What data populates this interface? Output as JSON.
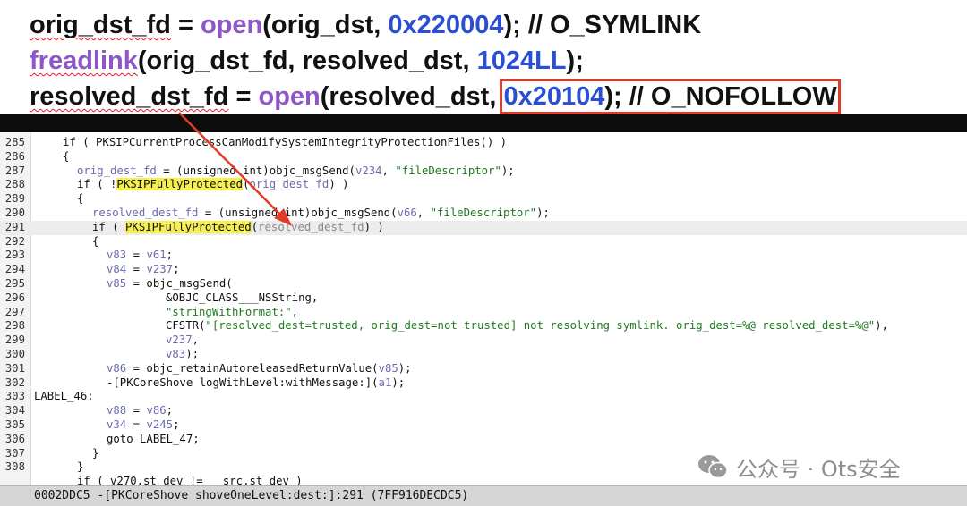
{
  "banner": {
    "line1": {
      "a": "orig_dst_fd",
      "b": " = ",
      "fn": "open",
      "c": "(orig_dst, ",
      "num": "0x220004",
      "d": "); // O_SYMLINK"
    },
    "line2": {
      "fn": "freadlink",
      "c": "(orig_dst_fd, resolved_dst, ",
      "num": "1024LL",
      "d": ");"
    },
    "line3": {
      "a": "resolved_dst_fd",
      "b": " = ",
      "fn": "open",
      "c": "(resolved_dst, ",
      "num": "0x20104",
      "d": "); // O_NOFOLLOW"
    }
  },
  "code": {
    "ln": [
      "285",
      "286",
      "287",
      "288",
      "289",
      "290",
      "291",
      "292",
      "293",
      "294",
      "295",
      "296",
      "297",
      "298",
      "299",
      "300",
      "301",
      "302",
      "303",
      "304",
      "305",
      "306",
      "307",
      "308"
    ],
    "l285": "if ( PKSIPCurrentProcessCanModifySystemIntegrityProtectionFiles() )",
    "l286": "{",
    "l287a": "orig_dest_fd",
    "l287b": " = (unsigned int)objc_msgSend(",
    "l287c": "v234",
    "l287d": ", ",
    "l287e": "\"fileDescriptor\"",
    "l287f": ");",
    "l288a": "if ( !",
    "l288b": "PKSIPFullyProtected",
    "l288c": "(",
    "l288d": "orig_dest_fd",
    "l288e": ") )",
    "l289": "{",
    "l290a": "resolved_dest_fd",
    "l290b": " = (unsigned int)objc_msgSend(",
    "l290c": "v66",
    "l290d": ", ",
    "l290e": "\"fileDescriptor\"",
    "l290f": ");",
    "l291a": "if ( ",
    "l291b": "PKSIPFullyProtected",
    "l291c": "(",
    "l291d": "resolved_dest_fd",
    "l291e": ") )",
    "l292": "{",
    "l293a": "v83",
    "l293b": " = ",
    "l293c": "v61",
    "l293d": ";",
    "l294a": "v84",
    "l294b": " = ",
    "l294c": "v237",
    "l294d": ";",
    "l295a": "v85",
    "l295b": " = objc_msgSend(",
    "l296": "&OBJC_CLASS___NSString,",
    "l297a": "\"stringWithFormat:\"",
    "l297b": ",",
    "l298a": "CFSTR(",
    "l298b": "\"[resolved_dest=trusted, orig_dest=not trusted] not resolving symlink. orig_dest=%@ resolved_dest=%@\"",
    "l298c": "),",
    "l299a": "v237",
    "l299b": ",",
    "l300a": "v83",
    "l300b": ");",
    "l301a": "v86",
    "l301b": " = objc_retainAutoreleasedReturnValue(",
    "l301c": "v85",
    "l301d": ");",
    "l302a": "-[PKCoreShove logWithLevel:withMessage:](",
    "l302b": "a1",
    "l302c": ");",
    "l303": "LABEL_46:",
    "l304a": "v88",
    "l304b": " = ",
    "l304c": "v86",
    "l304d": ";",
    "l305a": "v34",
    "l305b": " = ",
    "l305c": "v245",
    "l305d": ";",
    "l306": "goto LABEL_47;",
    "l307": "}",
    "l308": "}",
    "l309": "if ( v270.st_dev != __src.st_dev )"
  },
  "status": "0002DDC5 -[PKCoreShove shoveOneLevel:dest:]:291 (7FF916DECDC5)",
  "watermark": "公众号 · Ots安全",
  "colors": {
    "keyword": "#8e57c7",
    "number": "#2a4fd6",
    "string": "#1e7a1e",
    "variable": "#6b6bb0",
    "highlight": "#f5f050",
    "annotation": "#e03a2a"
  }
}
